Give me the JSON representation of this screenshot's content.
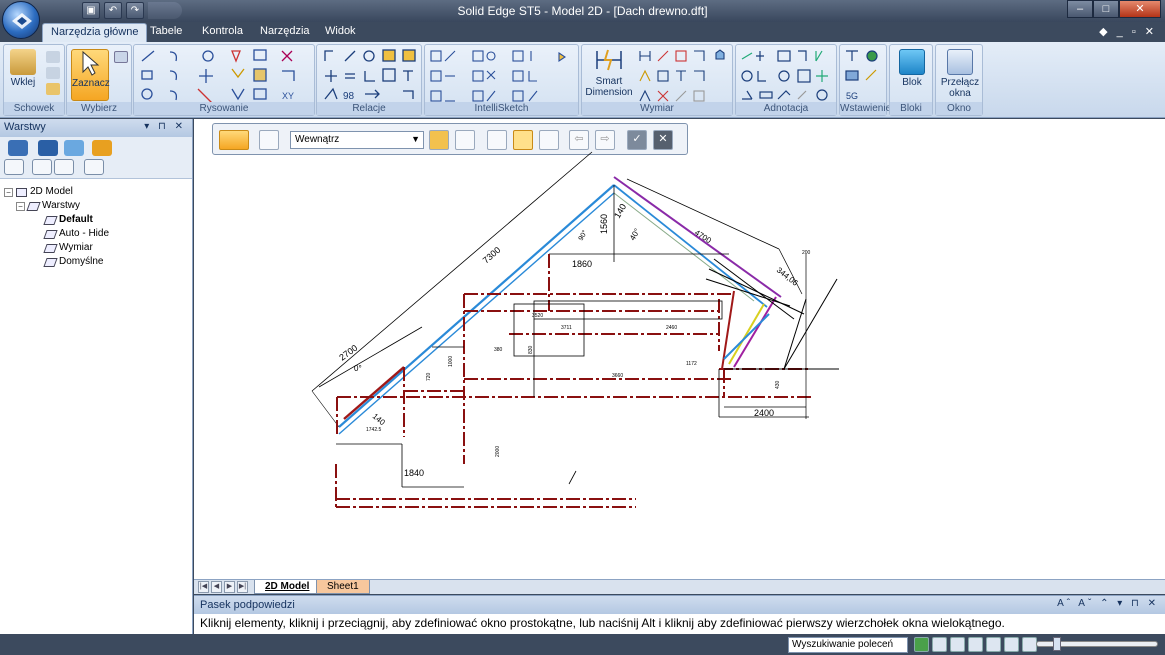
{
  "window": {
    "title": "Solid Edge ST5 - Model 2D - [Dach drewno.dft]"
  },
  "ribbon": {
    "tabs": [
      "Narzędzia główne",
      "Tabele",
      "Kontrola",
      "Narzędzia",
      "Widok"
    ],
    "active_tab": "Narzędzia główne",
    "groups": {
      "schowek": {
        "label": "Schowek",
        "paste": "Wklej"
      },
      "wybierz": {
        "label": "Wybierz",
        "select": "Zaznacz"
      },
      "rysowanie": {
        "label": "Rysowanie"
      },
      "relacje": {
        "label": "Relacje"
      },
      "intellisketch": {
        "label": "IntelliSketch"
      },
      "wymiar": {
        "label": "Wymiar",
        "smart_line1": "Smart",
        "smart_line2": "Dimension"
      },
      "adnotacja": {
        "label": "Adnotacja"
      },
      "wstawienie": {
        "label": "Wstawienie"
      },
      "bloki": {
        "label": "Bloki",
        "blok": "Blok"
      },
      "okno": {
        "label": "Okno",
        "switch_line1": "Przełącz",
        "switch_line2": "okna"
      }
    }
  },
  "layers_panel": {
    "title": "Warstwy",
    "tree": {
      "root": "2D Model",
      "group": "Warstwy",
      "layers": [
        {
          "name": "Default",
          "active": true
        },
        {
          "name": "Auto - Hide",
          "active": false
        },
        {
          "name": "Wymiar",
          "active": false
        },
        {
          "name": "Domyślne",
          "active": false
        }
      ]
    }
  },
  "select_toolbar": {
    "mode": "Wewnątrz"
  },
  "drawing": {
    "dims": [
      "7300",
      "2700",
      "1560",
      "140",
      "40°",
      "4700",
      "1860",
      "344,06",
      "2400",
      "1840",
      "140",
      "0°",
      "90°",
      "2000",
      "380",
      "3520",
      "3660",
      "3711",
      "2460",
      "1000",
      "830",
      "720",
      "1742.5",
      "1172",
      "430",
      "200"
    ]
  },
  "sheet_tabs": [
    "2D Model",
    "Sheet1"
  ],
  "hint": {
    "title": "Pasek podpowiedzi",
    "text": "Kliknij elementy, kliknij i przeciągnij, aby zdefiniować okno prostokątne, lub naciśnij Alt i kliknij aby zdefiniować pierwszy wierzchołek okna wielokątnego."
  },
  "status": {
    "command_search": "Wyszukiwanie poleceń"
  }
}
